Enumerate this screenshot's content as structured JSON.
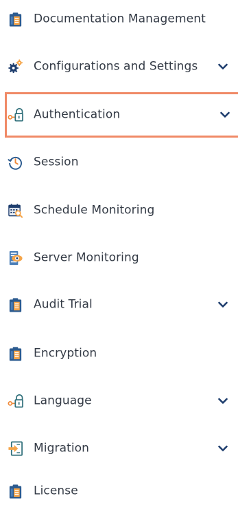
{
  "menu": {
    "items": [
      {
        "label": "Documentation Management",
        "icon": "clipboard-icon",
        "has_chevron": false
      },
      {
        "label": "Configurations and Settings",
        "icon": "gears-icon",
        "has_chevron": true
      },
      {
        "label": "Authentication",
        "icon": "key-lock-icon",
        "has_chevron": true,
        "active": true
      },
      {
        "label": "Session",
        "icon": "clock-history-icon",
        "has_chevron": false
      },
      {
        "label": "Schedule Monitoring",
        "icon": "calendar-search-icon",
        "has_chevron": false
      },
      {
        "label": "Server Monitoring",
        "icon": "server-eye-icon",
        "has_chevron": false
      },
      {
        "label": "Audit Trial",
        "icon": "clipboard-icon",
        "has_chevron": true
      },
      {
        "label": "Encryption",
        "icon": "clipboard-icon",
        "has_chevron": false
      },
      {
        "label": "Language",
        "icon": "key-lock-icon",
        "has_chevron": true
      },
      {
        "label": "Migration",
        "icon": "import-arrow-icon",
        "has_chevron": true
      },
      {
        "label": "License",
        "icon": "clipboard-icon",
        "has_chevron": false
      }
    ]
  },
  "colors": {
    "active_border": "#f08a67",
    "text": "#333a45",
    "chevron": "#1f3e6e",
    "clipboard_blue": "#2c5b8f",
    "clipboard_orange": "#f5a54a",
    "key_orange": "#f08a3a",
    "lock_teal": "#2f6f7a"
  }
}
